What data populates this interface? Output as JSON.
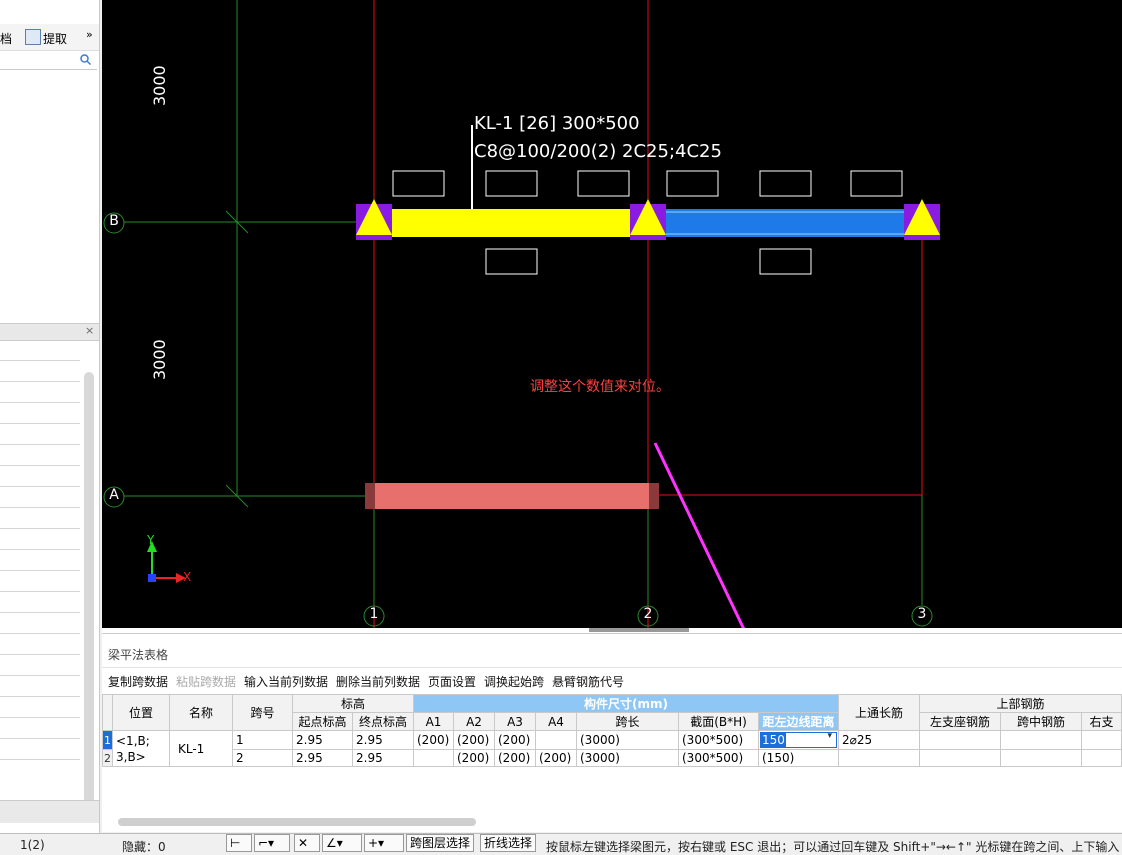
{
  "left_panel": {
    "toolbar": {
      "doc_label": "档",
      "extract_label": "提取",
      "more_glyph": "»"
    },
    "list_rows": 20
  },
  "canvas": {
    "beam_label_line1": "KL-1 [26] 300*500",
    "beam_label_line2": "C8@100/200(2) 2C25;4C25",
    "dimension_top": "3000",
    "dimension_bottom": "3000",
    "axis_rows": [
      "B",
      "A"
    ],
    "axis_cols": [
      "1",
      "2",
      "3"
    ],
    "annotation": "调整这个数值来对位。",
    "ucs_y": "Y",
    "ucs_x": "X",
    "colors": {
      "beam_selected": "#ffff00",
      "beam_other": "#1e7ae8",
      "beam_a": "#e8706c",
      "grid_red": "#e0101a",
      "grid_green": "#2a8a2a",
      "support": "#8a1be0",
      "annotation": "#ff4040",
      "arrow": "#ff33ff"
    }
  },
  "panel": {
    "title": "梁平法表格",
    "toolbar": [
      "复制跨数据",
      "粘贴跨数据",
      "输入当前列数据",
      "删除当前列数据",
      "页面设置",
      "调换起始跨",
      "悬臂钢筋代号"
    ],
    "toolbar_disabled_index": 1
  },
  "table": {
    "headers": {
      "position": "位置",
      "name": "名称",
      "span": "跨号",
      "elevation": "标高",
      "elev_start": "起点标高",
      "elev_end": "终点标高",
      "size": "构件尺寸(mm)",
      "a1": "A1",
      "a2": "A2",
      "a3": "A3",
      "a4": "A4",
      "span_len": "跨长",
      "section": "截面(B*H)",
      "edge_dist": "距左边线距离",
      "top_through": "上通长筋",
      "top_rebar": "上部钢筋",
      "left_seat": "左支座钢筋",
      "mid_span": "跨中钢筋",
      "right_seat": "右支"
    },
    "position_value": "<1,B;3,B>",
    "position_line1": "<1,B;",
    "position_line2": "3,B>",
    "name_value": "KL-1",
    "rows": [
      {
        "rownum": "1",
        "span": "1",
        "elev_start": "2.95",
        "elev_end": "2.95",
        "a1": "(200)",
        "a2": "(200)",
        "a3": "(200)",
        "a4": "",
        "span_len": "(3000)",
        "section": "(300*500)",
        "edge_dist": "150",
        "top_through": "2⌀25"
      },
      {
        "rownum": "2",
        "span": "2",
        "elev_start": "2.95",
        "elev_end": "2.95",
        "a1": "",
        "a2": "(200)",
        "a3": "(200)",
        "a4": "(200)",
        "span_len": "(3000)",
        "section": "(300*500)",
        "edge_dist": "(150)",
        "top_through": ""
      }
    ]
  },
  "status": {
    "page": "1(2)",
    "hidden": "隐藏：0",
    "cross_layer": "跨图层选择",
    "polyline": "折线选择",
    "hint": "按鼠标左键选择梁图元，按右键或 ESC 退出；可以通过回车键及 Shift+\"→←↑\" 光标键在跨之间、上下输入"
  }
}
